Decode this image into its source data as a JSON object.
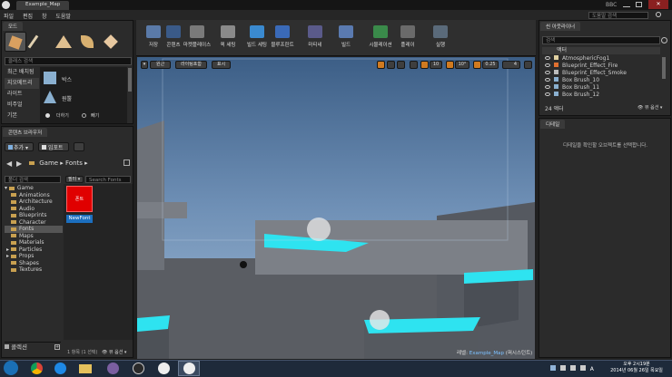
{
  "window": {
    "title": "Example_Map",
    "user": "BBC"
  },
  "menu": [
    "파일",
    "편집",
    "창",
    "도움말"
  ],
  "search_help": "도움말 검색",
  "modes": {
    "tab": "모드",
    "search_placeholder": "클래스 검색",
    "categories": [
      "최근 배치됨",
      "지오메트리",
      "라이트",
      "비주얼",
      "기본"
    ],
    "items": [
      "박스",
      "원뿔"
    ],
    "brush_add": "더하기",
    "brush_sub": "빼기"
  },
  "content_browser": {
    "tab": "콘텐츠 브라우저",
    "add": "추가",
    "import": "임포트",
    "path": [
      "Game",
      "Fonts"
    ],
    "folder_search": "폴더 검색",
    "filter": "필터",
    "search_placeholder": "Search Fonts",
    "tree": [
      "Game",
      "Animations",
      "Architecture",
      "Audio",
      "Blueprints",
      "Character",
      "Fonts",
      "Maps",
      "Materials",
      "Particles",
      "Props",
      "Shapes",
      "Textures"
    ],
    "selected_folder": "Fonts",
    "asset_type": "폰트",
    "asset_name": "NewFont",
    "collections": "콜렉션",
    "status": "1 항목 (1 선택)",
    "view_options": "뷰 옵션"
  },
  "toolbar": [
    {
      "label": "저장",
      "icon": "save-icon"
    },
    {
      "label": "콘텐츠",
      "icon": "content-icon"
    },
    {
      "label": "마켓플레이스",
      "icon": "marketplace-icon"
    },
    {
      "label": "퀵 세팅",
      "icon": "settings-icon"
    },
    {
      "label": "빌드 세팅",
      "icon": "world-icon"
    },
    {
      "label": "블루프린트",
      "icon": "blueprint-icon"
    },
    {
      "label": "마티네",
      "icon": "matinee-icon"
    },
    {
      "label": "빌드",
      "icon": "build-icon"
    },
    {
      "label": "시뮬레이션",
      "icon": "simulate-icon"
    },
    {
      "label": "플레이",
      "icon": "play-icon"
    },
    {
      "label": "실행",
      "icon": "launch-icon"
    }
  ],
  "viewport": {
    "perspective": "원근",
    "lit": "라이팅포함",
    "show": "표시",
    "grid_snap": "10",
    "rot_snap": "10°",
    "scale_snap": "0.25",
    "cam_speed": "4",
    "level_label": "레벨:",
    "level_name": "Example_Map",
    "level_suffix": "(퍼시스턴트)"
  },
  "outliner": {
    "tab": "씬 아웃라이너",
    "search_placeholder": "검색",
    "header": "액터",
    "rows": [
      "AtmosphericFog1",
      "Blueprint_Effect_Fire",
      "Blueprint_Effect_Smoke",
      "Box Brush_10",
      "Box Brush_11",
      "Box Brush_12"
    ],
    "count": "24 액터",
    "view_options": "뷰 옵션"
  },
  "details": {
    "tab": "디테일",
    "empty": "디테일을 확인할 오브젝트를 선택합니다."
  },
  "taskbar": {
    "time": "오후 2시19분",
    "date": "2014년 06월 26일 목요일",
    "ime": "A"
  },
  "colors": {
    "accent": "#1c8fdb",
    "cyan": "#2ee3f0",
    "font_asset": "#e00000"
  }
}
